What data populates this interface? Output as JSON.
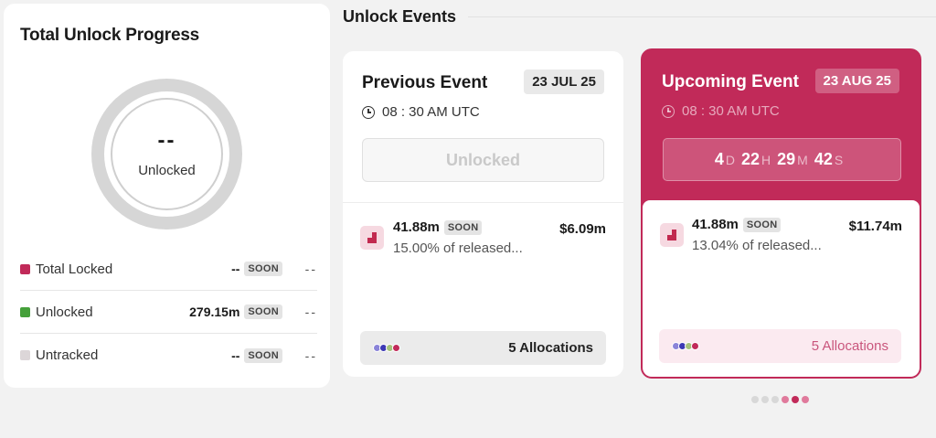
{
  "progress": {
    "title": "Total Unlock Progress",
    "center_value": "--",
    "center_label": "Unlocked",
    "legend": [
      {
        "name": "Total Locked",
        "value": "--",
        "badge": "SOON",
        "dash": "--",
        "color": "#c12a59"
      },
      {
        "name": "Unlocked",
        "value": "279.15m",
        "badge": "SOON",
        "dash": "--",
        "color": "#45a03a"
      },
      {
        "name": "Untracked",
        "value": "--",
        "badge": "SOON",
        "dash": "--",
        "color": "#dcd6d8"
      }
    ]
  },
  "events": {
    "section_title": "Unlock Events",
    "previous": {
      "title": "Previous Event",
      "date": "23 JUL 25",
      "time": "08 : 30 AM UTC",
      "button_label": "Unlocked",
      "amount": "41.88m",
      "badge": "SOON",
      "usd": "$6.09m",
      "desc": "15.00% of released...",
      "allocations": "5 Allocations"
    },
    "upcoming": {
      "title": "Upcoming Event",
      "date": "23 AUG 25",
      "time": "08 : 30 AM UTC",
      "countdown": {
        "d": "4",
        "d_unit": "D",
        "h": "22",
        "h_unit": "H",
        "m": "29",
        "m_unit": "M",
        "s": "42",
        "s_unit": "S"
      },
      "amount": "41.88m",
      "badge": "SOON",
      "usd": "$11.74m",
      "desc": "13.04% of released...",
      "allocations": "5 Allocations"
    }
  },
  "colors": {
    "accent": "#c12a59",
    "dots": [
      "#8a84d8",
      "#3d39b4",
      "#a6c27c",
      "#c12a59"
    ]
  },
  "pager": {
    "active": [
      3,
      4,
      5
    ],
    "total": 6
  }
}
